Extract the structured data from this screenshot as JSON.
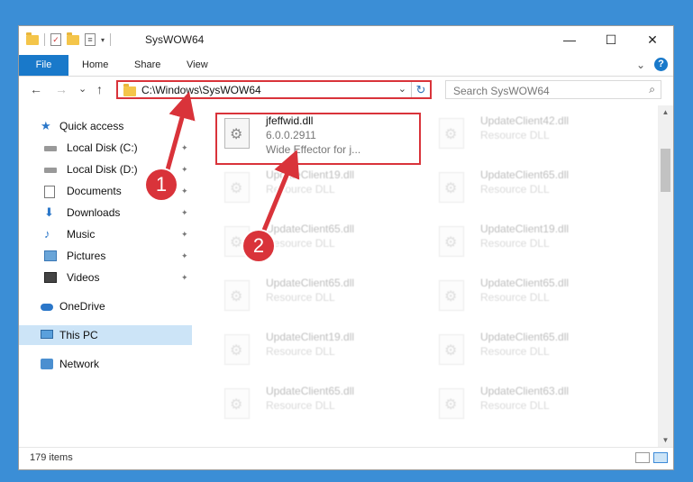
{
  "window": {
    "title": "SysWOW64",
    "buttons": {
      "minimize": "—",
      "maximize": "☐",
      "close": "✕"
    }
  },
  "ribbon": {
    "tabs": [
      "File",
      "Home",
      "Share",
      "View"
    ],
    "expand_caret": "⌄",
    "help": "?"
  },
  "address": {
    "path": "C:\\Windows\\SysWOW64",
    "dropdown": "⌄",
    "refresh": "↻"
  },
  "search": {
    "placeholder": "Search SysWOW64",
    "icon": "⌕"
  },
  "nav": {
    "back": "←",
    "forward": "→",
    "recent": "⌄",
    "up": "↑"
  },
  "navpane": [
    {
      "label": "Quick access",
      "icon": "star-icon"
    },
    {
      "label": "Local Disk (C:)",
      "icon": "disk-icon",
      "pinned": true
    },
    {
      "label": "Local Disk (D:)",
      "icon": "disk-icon",
      "pinned": true
    },
    {
      "label": "Documents",
      "icon": "documents-icon",
      "pinned": true
    },
    {
      "label": "Downloads",
      "icon": "downloads-icon",
      "pinned": true
    },
    {
      "label": "Music",
      "icon": "music-icon",
      "pinned": true
    },
    {
      "label": "Pictures",
      "icon": "pictures-icon",
      "pinned": true
    },
    {
      "label": "Videos",
      "icon": "videos-icon",
      "pinned": true
    },
    {
      "label": "OneDrive",
      "icon": "cloud-icon"
    },
    {
      "label": "This PC",
      "icon": "pc-icon",
      "selected": true
    },
    {
      "label": "Network",
      "icon": "network-icon"
    }
  ],
  "files": [
    {
      "name": "jfeffwid.dll",
      "version": "6.0.0.2911",
      "desc": "Wide Effector for j..."
    },
    {
      "name": "UpdateClient42.dll",
      "desc": "Resource DLL"
    },
    {
      "name": "UpdateClient19.dll",
      "desc": "Resource DLL"
    },
    {
      "name": "UpdateClient65.dll",
      "desc": "Resource DLL"
    },
    {
      "name": "UpdateClient65.dll",
      "desc": "Resource DLL"
    },
    {
      "name": "UpdateClient19.dll",
      "desc": "Resource DLL"
    },
    {
      "name": "UpdateClient65.dll",
      "desc": "Resource DLL"
    },
    {
      "name": "UpdateClient65.dll",
      "desc": "Resource DLL"
    },
    {
      "name": "UpdateClient19.dll",
      "desc": "Resource DLL"
    },
    {
      "name": "UpdateClient65.dll",
      "desc": "Resource DLL"
    },
    {
      "name": "UpdateClient65.dll",
      "desc": "Resource DLL"
    },
    {
      "name": "UpdateClient63.dll",
      "desc": "Resource DLL"
    }
  ],
  "status": {
    "count": "179 items"
  },
  "callouts": [
    "1",
    "2"
  ],
  "colors": {
    "accent": "#1979ca",
    "annotation": "#d9333a",
    "desktop": "#3b8ed6"
  },
  "pin_glyph": "📌"
}
